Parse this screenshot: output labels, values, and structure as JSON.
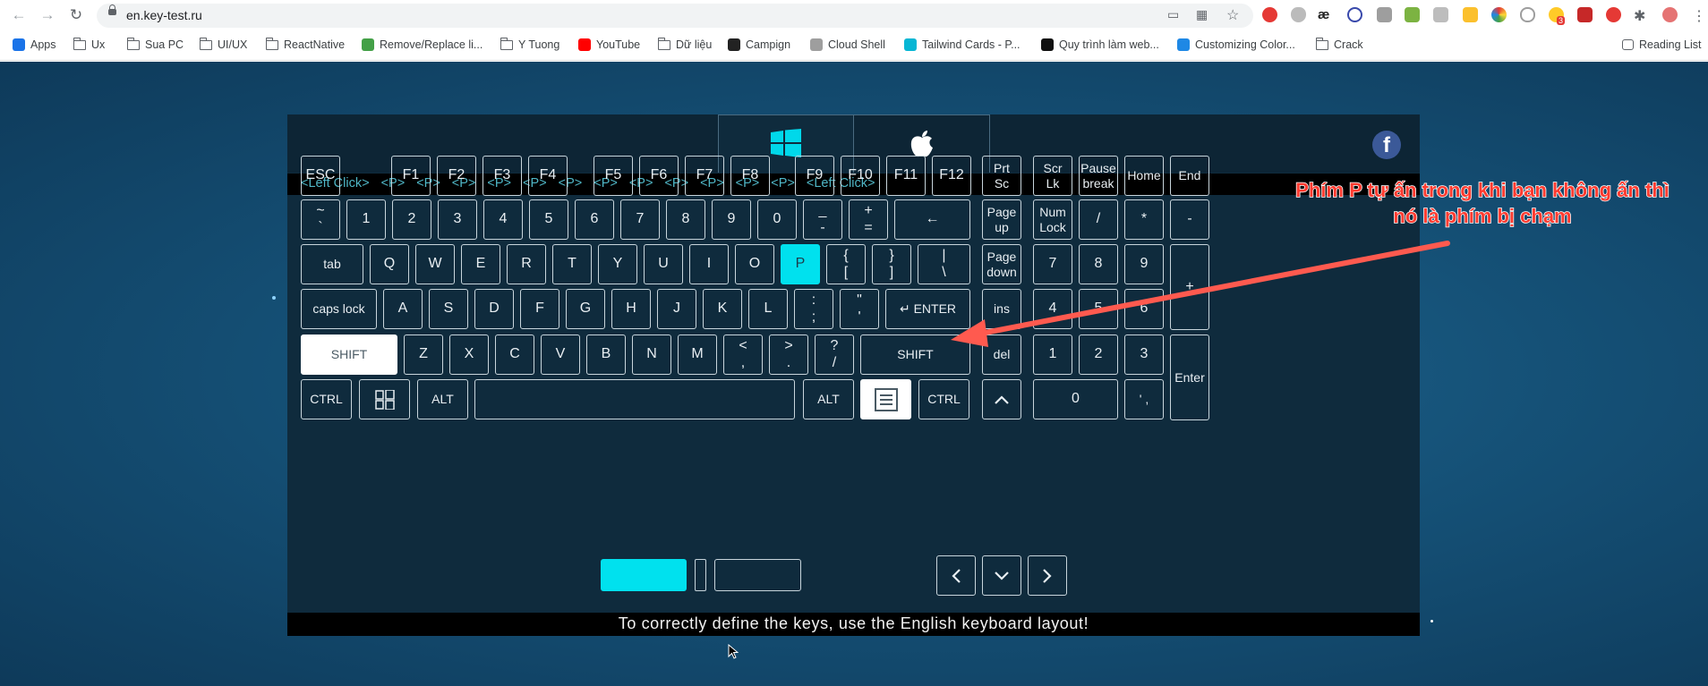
{
  "browser": {
    "url": "en.key-test.ru",
    "bookmarks": [
      {
        "label": "Apps",
        "icon": "apps-grid-icon"
      },
      {
        "label": "Ux",
        "icon": "folder-icon"
      },
      {
        "label": "Sua PC",
        "icon": "folder-icon"
      },
      {
        "label": "UI/UX",
        "icon": "folder-icon"
      },
      {
        "label": "ReactNative",
        "icon": "folder-icon"
      },
      {
        "label": "Remove/Replace li...",
        "icon": "green-diamond-icon"
      },
      {
        "label": "Y Tuong",
        "icon": "folder-icon"
      },
      {
        "label": "YouTube",
        "icon": "youtube-icon"
      },
      {
        "label": "Dữ liệu",
        "icon": "folder-icon"
      },
      {
        "label": "Campign",
        "icon": "campign-icon"
      },
      {
        "label": "Cloud Shell",
        "icon": "cloud-shell-icon"
      },
      {
        "label": "Tailwind Cards - P...",
        "icon": "tailwind-icon"
      },
      {
        "label": "Quy trình làm web...",
        "icon": "notion-icon"
      },
      {
        "label": "Customizing Color...",
        "icon": "wave-icon"
      },
      {
        "label": "Crack",
        "icon": "folder-icon"
      }
    ],
    "reading_list": "Reading List",
    "ext_badge": "3"
  },
  "event_log": [
    "<Left Click>",
    "<P>",
    "<P>",
    "<P>",
    "<P>",
    "<P>",
    "<P>",
    "<P>",
    "<P>",
    "<P>",
    "<P>",
    "<P>",
    "<P>",
    "<Left Click>"
  ],
  "facebook_label": "f",
  "keys": {
    "esc": "ESC",
    "f1": "F1",
    "f2": "F2",
    "f3": "F3",
    "f4": "F4",
    "f5": "F5",
    "f6": "F6",
    "f7": "F7",
    "f8": "F8",
    "f9": "F9",
    "f10": "F10",
    "f11": "F11",
    "f12": "F12",
    "prtsc1": "Prt",
    "prtsc2": "Sc",
    "scrlk1": "Scr",
    "scrlk2": "Lk",
    "pause1": "Pause",
    "pause2": "break",
    "home": "Home",
    "end": "End",
    "tilde1": "~",
    "tilde2": "`",
    "n1": "1",
    "n2": "2",
    "n3": "3",
    "n4": "4",
    "n5": "5",
    "n6": "6",
    "n7": "7",
    "n8": "8",
    "n9": "9",
    "n0": "0",
    "minus1": "_",
    "minus2": "-",
    "plus1": "+",
    "plus2": "=",
    "backspace": "←",
    "pageup1": "Page",
    "pageup2": "up",
    "numlock1": "Num",
    "numlock2": "Lock",
    "npdiv": "/",
    "npmul": "*",
    "npsub": "-",
    "tab": "tab",
    "q": "Q",
    "w": "W",
    "e": "E",
    "r": "R",
    "t": "T",
    "y": "Y",
    "u": "U",
    "i": "I",
    "o": "O",
    "p": "P",
    "lbr1": "{",
    "lbr2": "[",
    "rbr1": "}",
    "rbr2": "]",
    "bsl1": "|",
    "bsl2": "\\",
    "pagedown1": "Page",
    "pagedown2": "down",
    "np7": "7",
    "np8": "8",
    "np9": "9",
    "npadd": "+",
    "caps": "caps lock",
    "a": "A",
    "s": "S",
    "d": "D",
    "f": "F",
    "g": "G",
    "h": "H",
    "j": "J",
    "k": "K",
    "l": "L",
    "semi1": ":",
    "semi2": ";",
    "quote1": "\"",
    "quote2": "'",
    "enter": "↵ ENTER",
    "ins": "ins",
    "np4": "4",
    "np5": "5",
    "np6": "6",
    "lshift": "SHIFT",
    "z": "Z",
    "x": "X",
    "c": "C",
    "v": "V",
    "b": "B",
    "n": "N",
    "m": "M",
    "comma1": "<",
    "comma2": ",",
    "dot1": ">",
    "dot2": ".",
    "slash1": "?",
    "slash2": "/",
    "rshift": "SHIFT",
    "del": "del",
    "np1": "1",
    "np2": "2",
    "np3": "3",
    "npenter": "Enter",
    "lctrl": "CTRL",
    "lalt": "ALT",
    "ralt": "ALT",
    "rctrl": "CTRL",
    "np0": "0",
    "npdot": "' ,"
  },
  "footer": "To correctly define the keys, use the English keyboard layout!",
  "annotation": "Phím P tự ấn trong khi bạn không ấn thì nó là phím bị chạm"
}
